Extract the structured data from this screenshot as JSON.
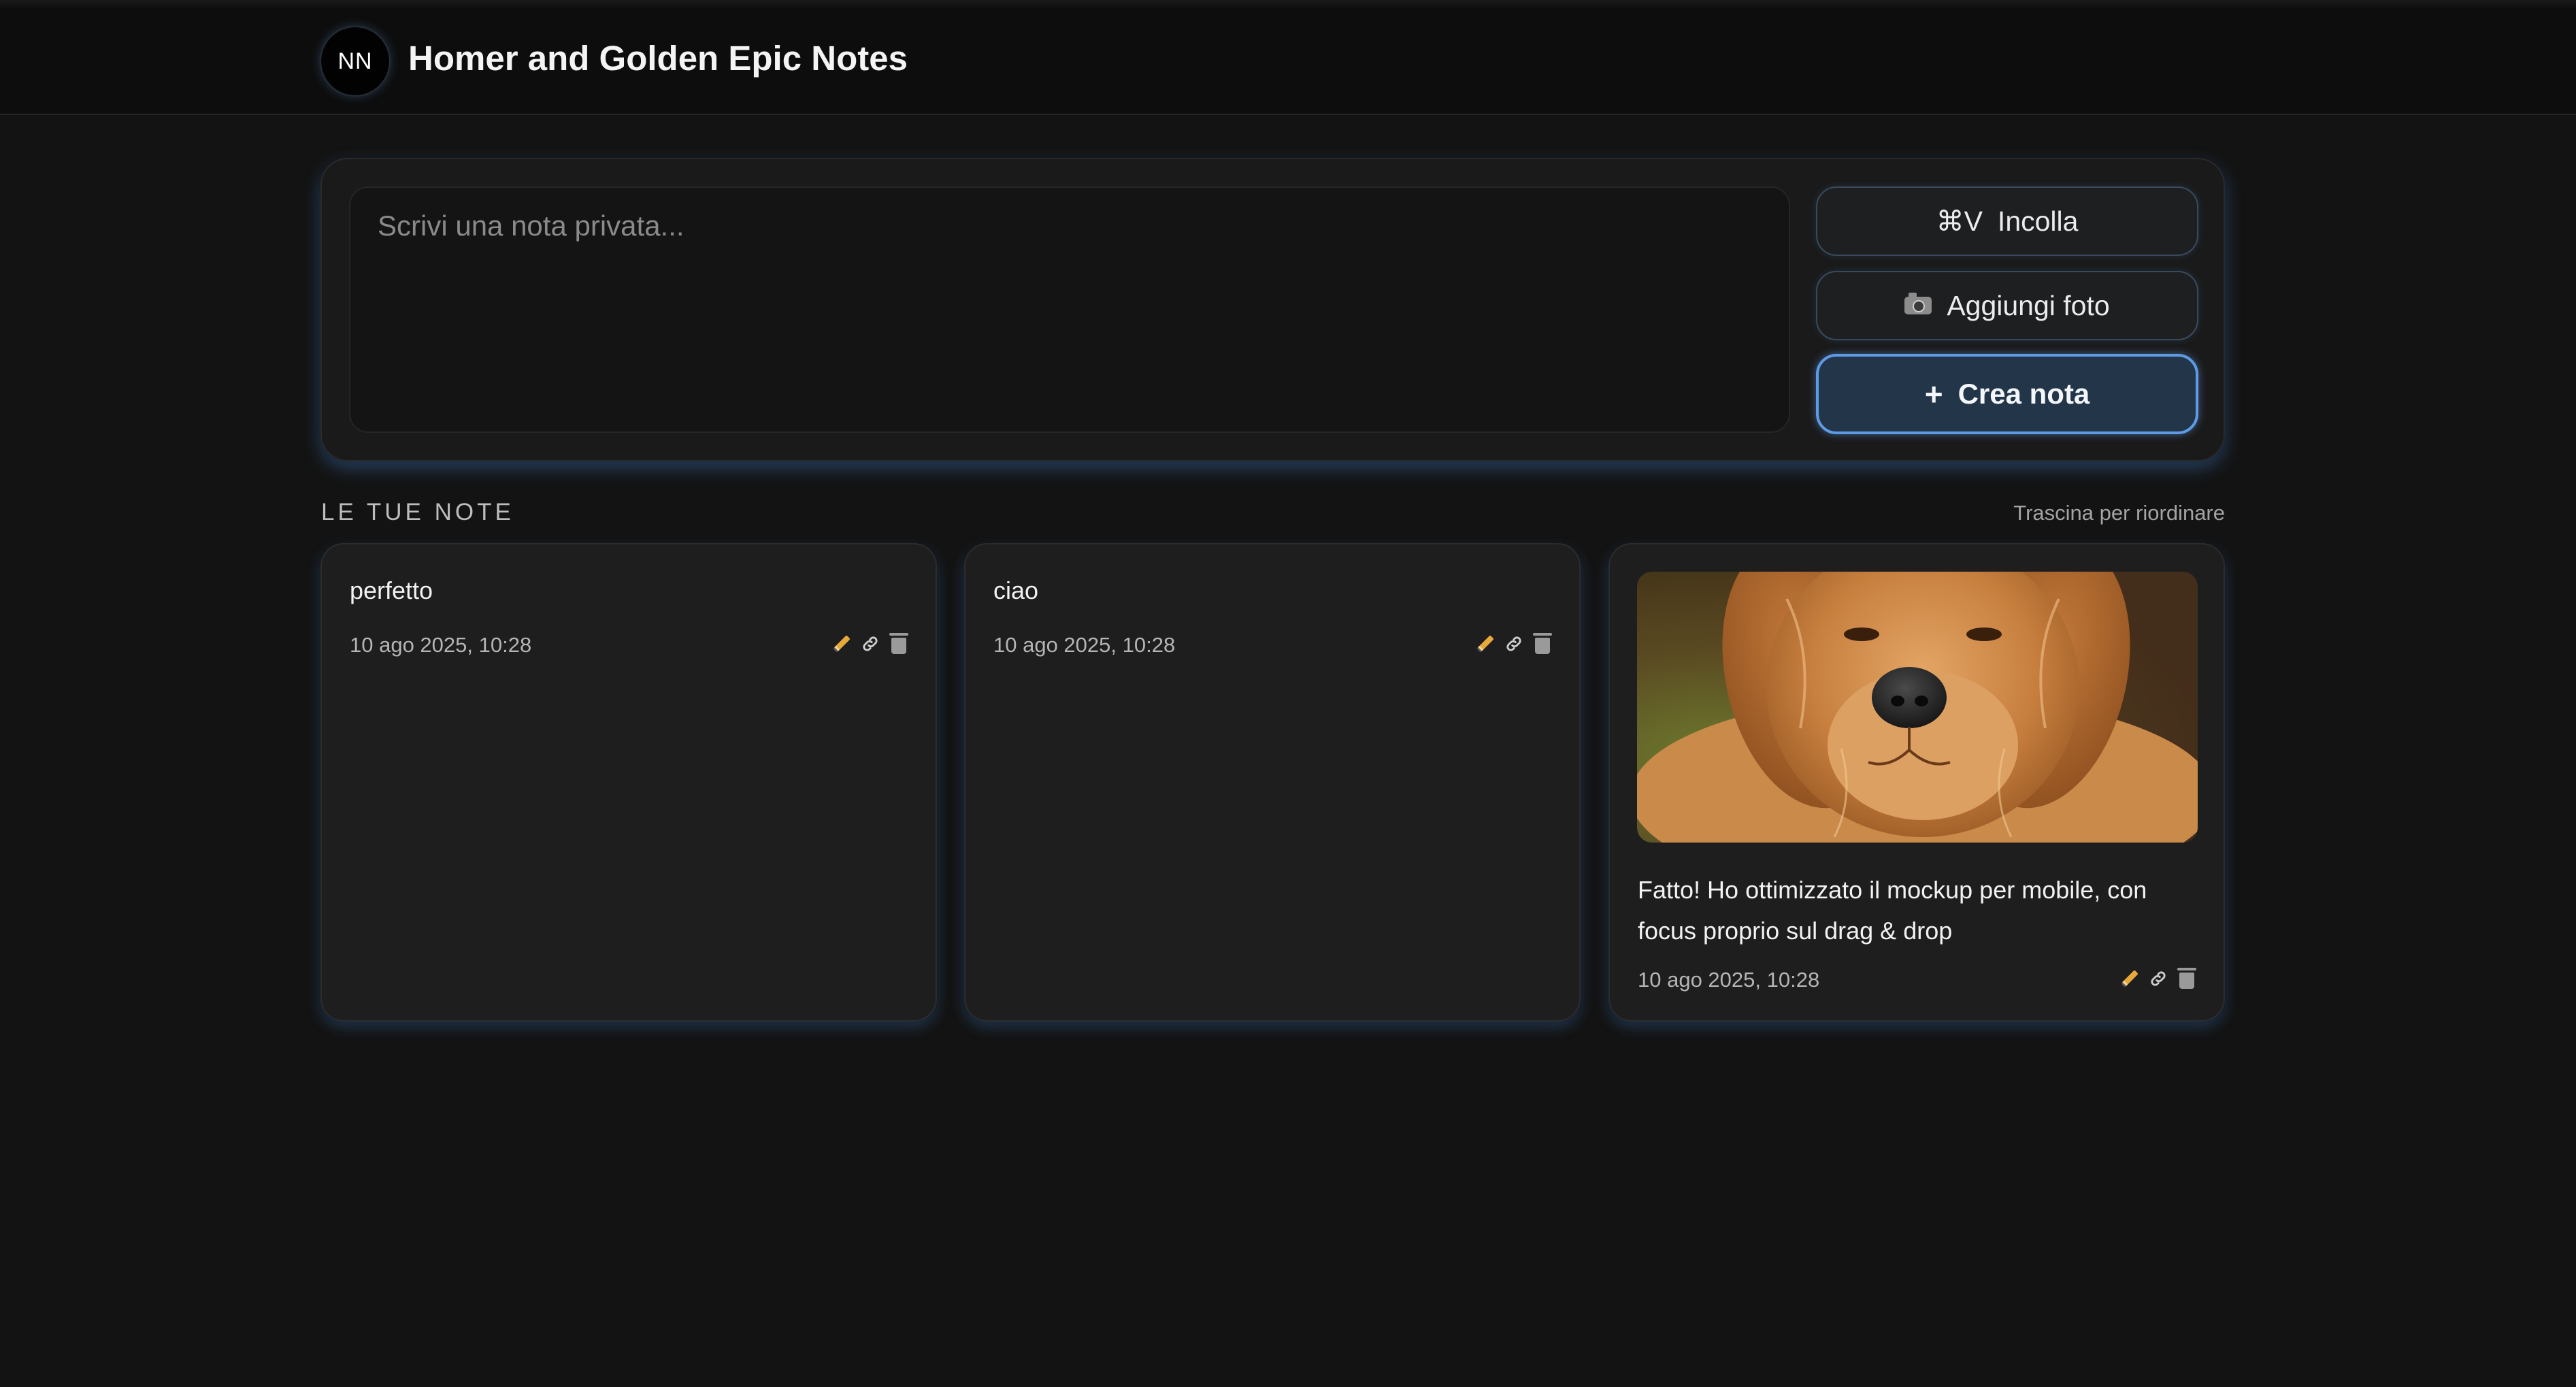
{
  "header": {
    "avatar_initials": "NN",
    "title": "Homer and Golden Epic Notes"
  },
  "composer": {
    "placeholder": "Scrivi una nota privata...",
    "paste_icon": "⌘V",
    "paste_label": "Incolla",
    "photo_label": "Aggiungi foto",
    "create_icon": "+",
    "create_label": "Crea nota"
  },
  "notes_section": {
    "title": "LE TUE NOTE",
    "hint": "Trascina per riordinare"
  },
  "notes": [
    {
      "text": "perfetto",
      "date": "10 ago 2025, 10:28",
      "has_image": false
    },
    {
      "text": "ciao",
      "date": "10 ago 2025, 10:28",
      "has_image": false
    },
    {
      "text": "Fatto! Ho ottimizzato il mockup per mobile, con focus proprio sul drag & drop",
      "date": "10 ago 2025, 10:28",
      "has_image": true,
      "image_subject": "golden retriever dog portrait"
    }
  ],
  "icons": {
    "edit": "pencil-icon",
    "link": "link-icon",
    "delete": "trash-icon",
    "photo": "camera-icon"
  },
  "colors": {
    "background": "#131313",
    "accent": "#5e9be6",
    "card": "#1e1e1e"
  }
}
